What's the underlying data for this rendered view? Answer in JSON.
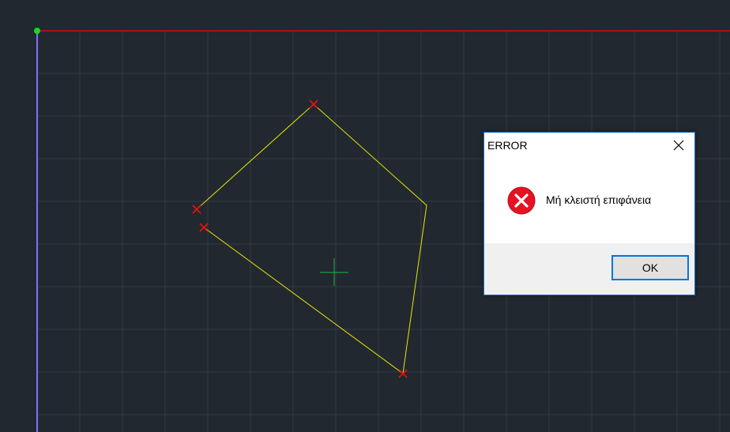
{
  "dialog": {
    "title": "ERROR",
    "message": "Μή κλειστή επιφάνεια",
    "ok_label": "OK",
    "close_icon": "close-icon",
    "status_icon": "error-icon",
    "error_color": "#e81123"
  },
  "canvas": {
    "background_color": "#212830",
    "grid_color": "#323a45",
    "x_axis_color": "#cc1111",
    "y_axis_color": "#7b72ff",
    "origin_color": "#1ed41e",
    "polyline_color": "#e8e800",
    "vertex_marker_color": "#ee1111",
    "crosshair_color": "#1f9e3a"
  }
}
